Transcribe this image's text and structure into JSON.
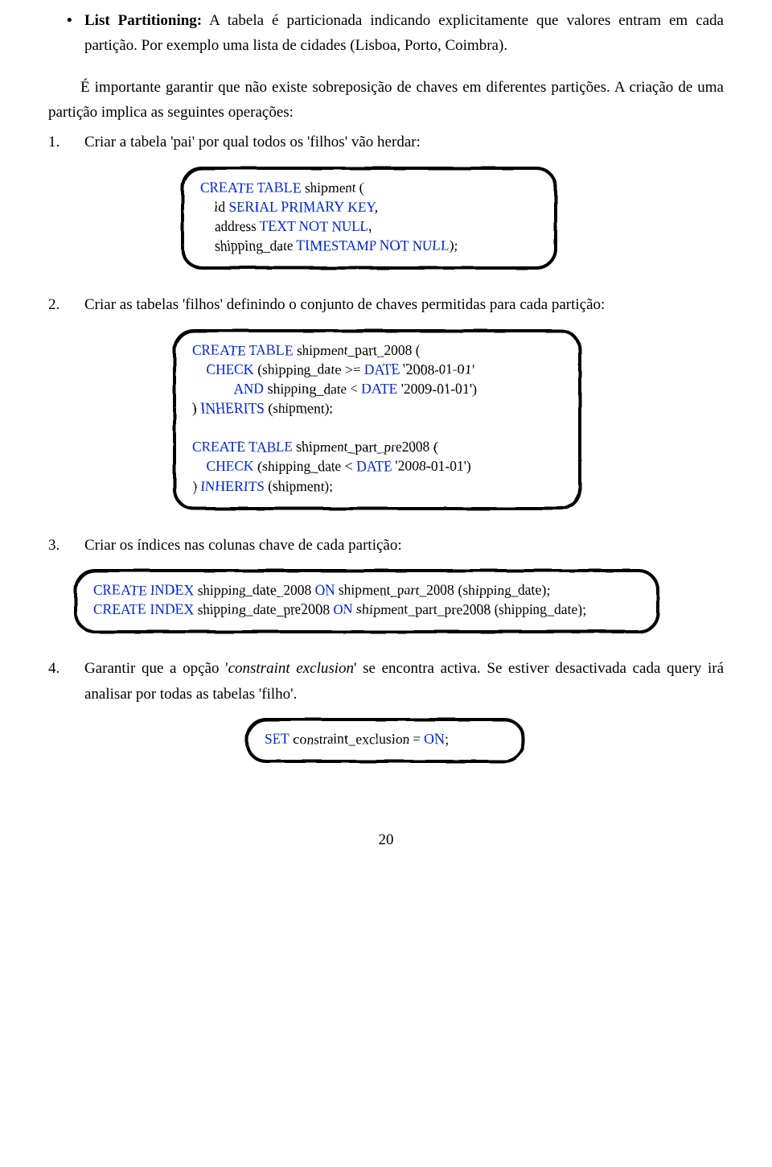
{
  "bullet": {
    "label": "List Partitioning:",
    "text": " A tabela é particionada indicando explicitamente que valores entram em cada partição. Por exemplo uma lista de cidades (Lisboa, Porto, Coimbra)."
  },
  "intro": "É importante garantir que não existe sobreposição de chaves em diferentes partições. A criação de uma partição implica as seguintes operações:",
  "steps": {
    "s1": {
      "num": "1.",
      "text": "Criar a tabela 'pai' por qual todos os 'filhos' vão herdar:"
    },
    "s2": {
      "num": "2.",
      "text": "Criar as tabelas 'filhos' definindo o conjunto de chaves permitidas para cada partição:"
    },
    "s3": {
      "num": "3.",
      "text": "Criar os índices nas colunas chave de cada partição:"
    },
    "s4": {
      "num": "4.",
      "pre": "Garantir que a opção '",
      "em": "constraint exclusion",
      "post": "' se encontra activa. Se estiver desactivada cada query irá analisar por todas as tabelas 'filho'."
    }
  },
  "code1": {
    "l1a": "CREATE TABLE",
    "l1b": " shipment (",
    "l2a": "    id ",
    "l2b": "SERIAL PRIMARY KEY",
    "l2c": ",",
    "l3a": "    address ",
    "l3b": "TEXT NOT NULL",
    "l3c": ",",
    "l4a": "    shipping_date ",
    "l4b": "TIMESTAMP NOT NULL",
    "l4c": ");"
  },
  "code2": {
    "l1a": "CREATE TABLE",
    "l1b": " shipment_part_2008 (",
    "l2a": "    CHECK",
    "l2b": " (shipping_date >= ",
    "l2c": "DATE",
    "l2d": " '2008-01-01'",
    "l3a": "            AND",
    "l3b": " shipping_date < ",
    "l3c": "DATE",
    "l3d": " '2009-01-01')",
    "l4a": ") ",
    "l4b": "INHERITS",
    "l4c": " (shipment);",
    "l5": "",
    "l6a": "CREATE TABLE",
    "l6b": " shipment_part_pre2008 (",
    "l7a": "    CHECK",
    "l7b": " (shipping_date < ",
    "l7c": "DATE",
    "l7d": " '2008-01-01')",
    "l8a": ") ",
    "l8b": "INHERITS",
    "l8c": " (shipment);"
  },
  "code3": {
    "l1a": "CREATE INDEX",
    "l1b": " shipping_date_2008 ",
    "l1c": "ON",
    "l1d": " shipment_part_2008 (shipping_date);",
    "l2a": "CREATE INDEX",
    "l2b": " shipping_date_pre2008 ",
    "l2c": "ON",
    "l2d": " shipment_part_pre2008 (shipping_date);"
  },
  "code4": {
    "l1a": "SET",
    "l1b": " constraint_exclusion = ",
    "l1c": "ON",
    "l1d": ";"
  },
  "pagenum": "20"
}
